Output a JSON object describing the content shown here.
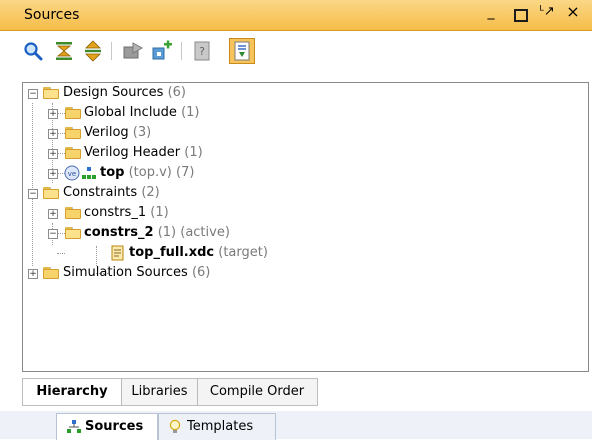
{
  "window": {
    "title": "Sources",
    "buttons": {
      "minimize": "_",
      "undock": "ᴸ↗",
      "close": "×"
    }
  },
  "toolbar": {
    "icons": [
      "search-icon",
      "collapse-all-icon",
      "expand-all-icon",
      "open-folder-icon",
      "add-sources-icon",
      "help-icon",
      "show-hierarchy-icon"
    ]
  },
  "tree": {
    "design_sources": {
      "label": "Design Sources",
      "count": "(6)"
    },
    "global_include": {
      "label": "Global Include",
      "count": "(1)"
    },
    "verilog": {
      "label": "Verilog",
      "count": "(3)"
    },
    "verilog_header": {
      "label": "Verilog Header",
      "count": "(1)"
    },
    "top": {
      "label": "top",
      "file": "(top.v)",
      "count": "(7)"
    },
    "constraints": {
      "label": "Constraints",
      "count": "(2)"
    },
    "constrs_1": {
      "label": "constrs_1",
      "count": "(1)"
    },
    "constrs_2": {
      "label": "constrs_2",
      "count": "(1)",
      "status": "(active)"
    },
    "top_full": {
      "label": "top_full.xdc",
      "status": "(target)"
    },
    "simulation_sources": {
      "label": "Simulation Sources",
      "count": "(6)"
    }
  },
  "view_tabs": [
    "Hierarchy",
    "Libraries",
    "Compile Order"
  ],
  "panel_tabs": [
    "Sources",
    "Templates"
  ],
  "colors": {
    "title_bar": "#f6bd49",
    "active_toolbar_button": "#f6c45a"
  }
}
